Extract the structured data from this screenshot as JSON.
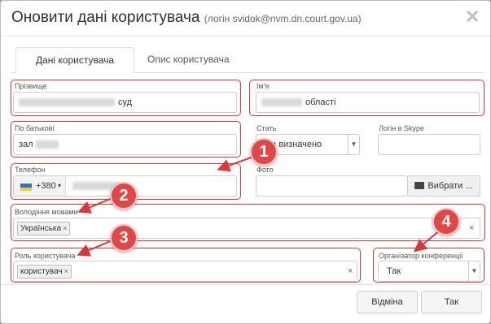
{
  "dialog": {
    "title": "Оновити дані користувача",
    "subtitle": "(логін svidok@nvm.dn.court.gov.ua)",
    "close_icon": "✕"
  },
  "tabs": [
    {
      "label": "Дані користувача",
      "active": true
    },
    {
      "label": "Опис користувача",
      "active": false
    }
  ],
  "form": {
    "surname": {
      "label": "Прізвище",
      "value_suffix": "суд"
    },
    "name": {
      "label": "Ім'я",
      "value_suffix": "області"
    },
    "patronymic": {
      "label": "По батькові",
      "value_prefix": "зал"
    },
    "gender": {
      "label": "Стать",
      "value": "Не визначено"
    },
    "skype": {
      "label": "Логін в Skype",
      "value": ""
    },
    "phone": {
      "label": "Телефон",
      "country_code": "+380",
      "flag": "ua-flag-icon"
    },
    "photo": {
      "label": "Фото",
      "button_label": "Вибрати ..."
    },
    "languages": {
      "label": "Володіння мовами",
      "tags": [
        "Українська"
      ]
    },
    "role": {
      "label": "Роль користувача",
      "tags": [
        "користувач"
      ]
    },
    "organizer": {
      "label": "Організатор конференції",
      "value": "Так"
    }
  },
  "annotations": [
    "1",
    "2",
    "3",
    "4"
  ],
  "buttons": {
    "cancel": "Відміна",
    "ok": "Так"
  },
  "colors": {
    "highlight": "#d9383a",
    "badge": "#e04848"
  }
}
